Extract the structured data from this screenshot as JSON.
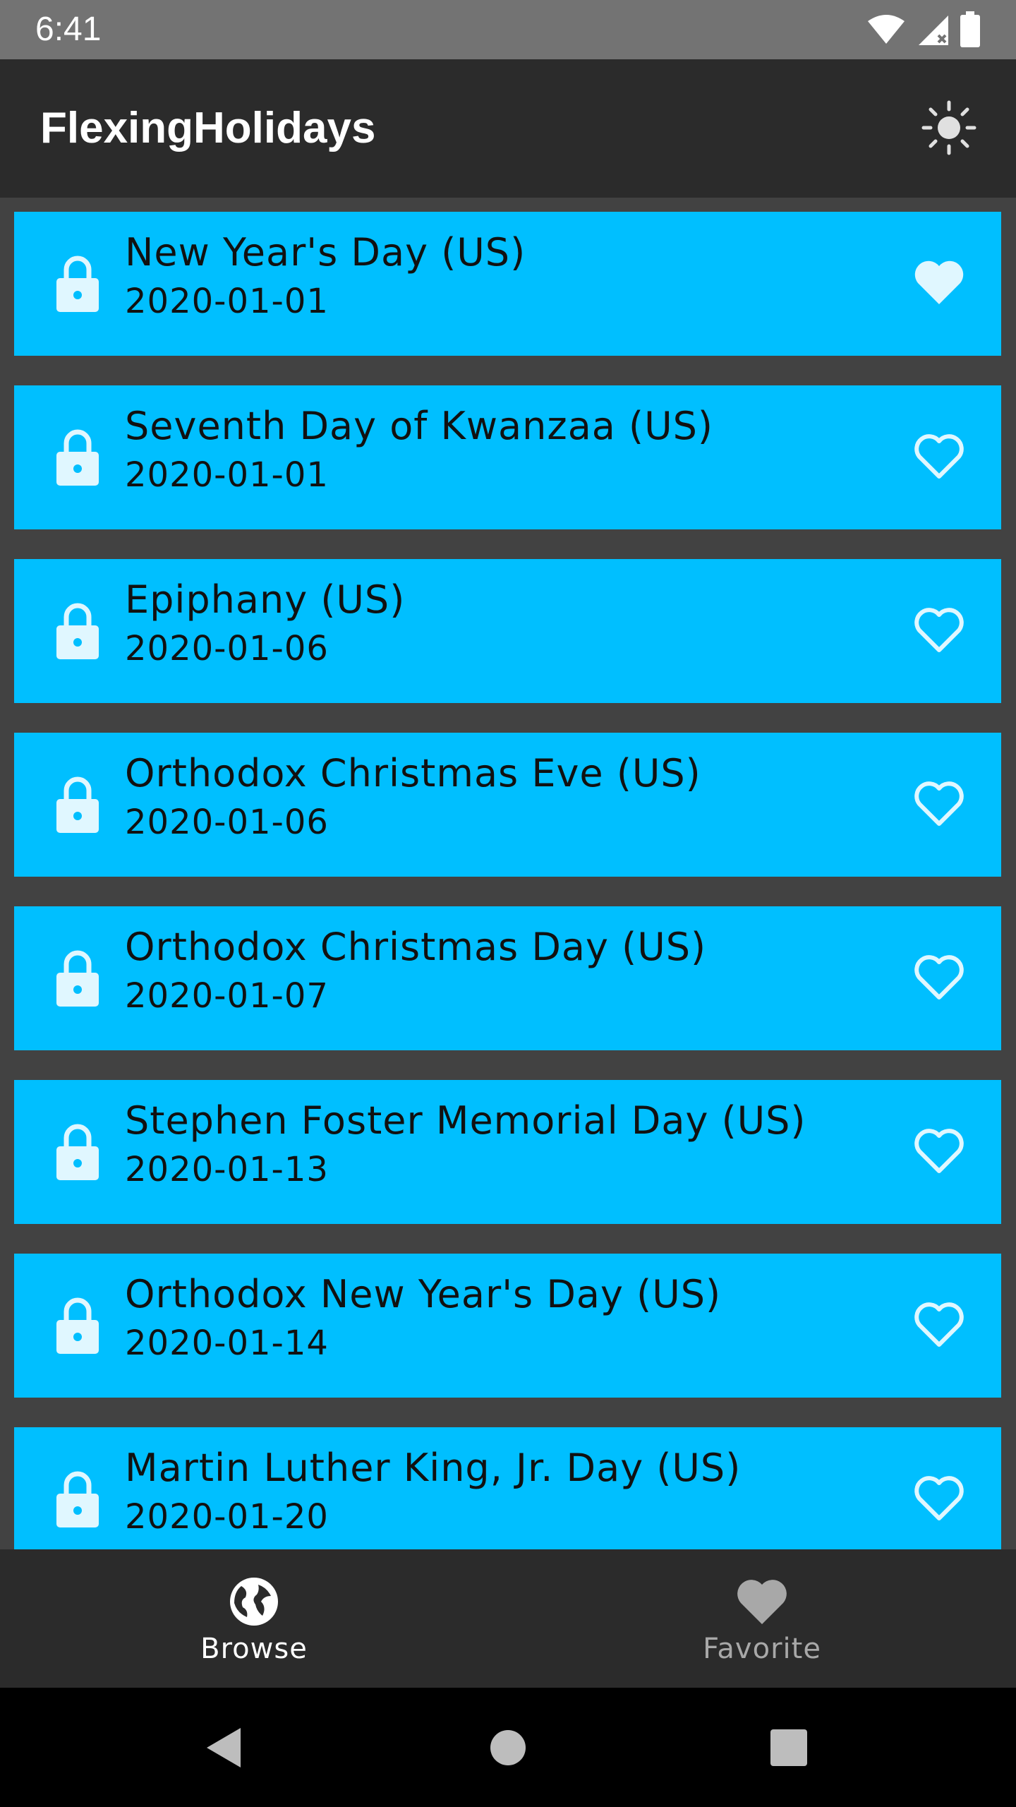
{
  "status_bar": {
    "time": "6:41",
    "icons": [
      "wifi-icon",
      "cell-signal-icon",
      "battery-icon"
    ]
  },
  "app_bar": {
    "title": "FlexingHolidays",
    "theme_toggle_icon": "sun-icon"
  },
  "colors": {
    "card_background": "#00bfff",
    "list_background": "#424242",
    "app_bar_background": "#2b2b2b",
    "status_bar_background": "#737373",
    "icon_tint": "#e0f7ff"
  },
  "holidays": [
    {
      "name": "New Year's Day (US)",
      "date": "2020-01-01",
      "favorite": true
    },
    {
      "name": "Seventh Day of Kwanzaa (US)",
      "date": "2020-01-01",
      "favorite": false
    },
    {
      "name": "Epiphany (US)",
      "date": "2020-01-06",
      "favorite": false
    },
    {
      "name": "Orthodox Christmas Eve (US)",
      "date": "2020-01-06",
      "favorite": false
    },
    {
      "name": "Orthodox Christmas Day (US)",
      "date": "2020-01-07",
      "favorite": false
    },
    {
      "name": "Stephen Foster Memorial Day (US)",
      "date": "2020-01-13",
      "favorite": false
    },
    {
      "name": "Orthodox New Year's Day (US)",
      "date": "2020-01-14",
      "favorite": false
    },
    {
      "name": "Martin Luther King, Jr. Day (US)",
      "date": "2020-01-20",
      "favorite": false
    }
  ],
  "bottom_nav": {
    "items": [
      {
        "label": "Browse",
        "icon": "globe-icon",
        "active": true
      },
      {
        "label": "Favorite",
        "icon": "heart-icon",
        "active": false
      }
    ]
  },
  "system_nav": {
    "buttons": [
      "back-icon",
      "home-icon",
      "recents-icon"
    ]
  }
}
